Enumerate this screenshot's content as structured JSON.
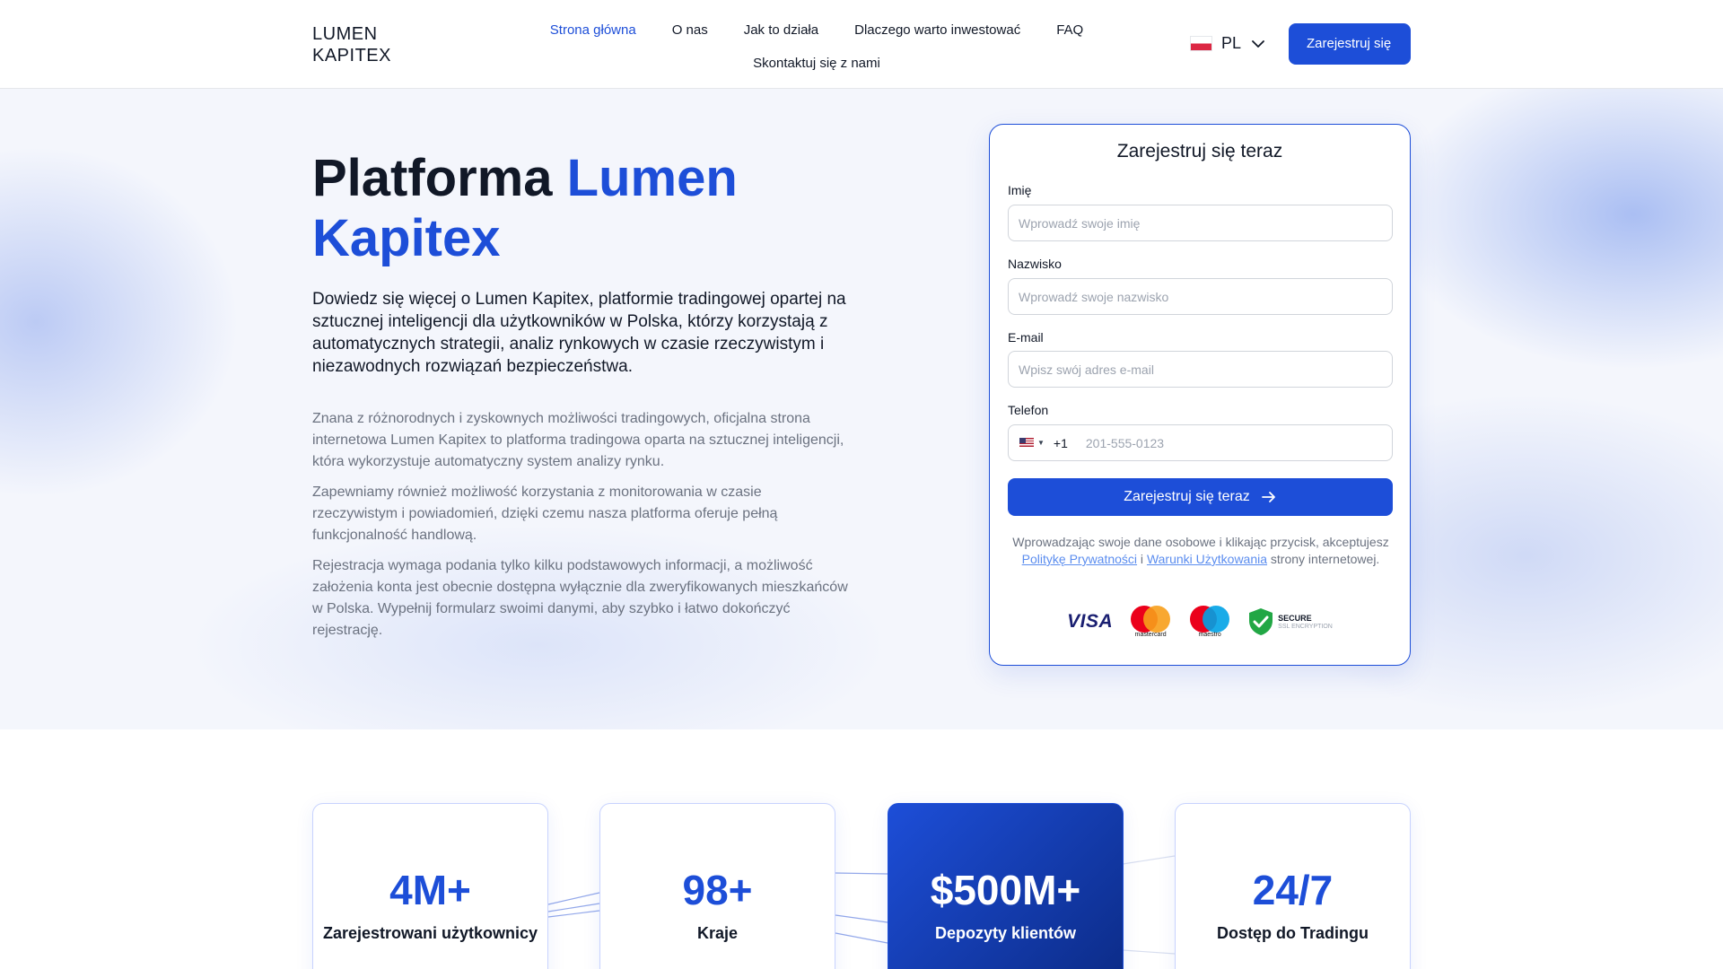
{
  "header": {
    "logo": "LUMEN\nKAPITEX",
    "nav": [
      "Strona główna",
      "O nas",
      "Jak to działa",
      "Dlaczego warto inwestować",
      "FAQ",
      "Skontaktuj się z nami"
    ],
    "language": "PL",
    "register_button": "Zarejestruj się"
  },
  "hero": {
    "title_part1": "Platforma ",
    "title_accent": "Lumen Kapitex",
    "lead": "Dowiedz się więcej o Lumen Kapitex, platformie tradingowej opartej na sztucznej inteligencji dla użytkowników w Polska, którzy korzystają z automatycznych strategii, analiz rynkowych w czasie rzeczywistym i niezawodnych rozwiązań bezpieczeństwa.",
    "paragraphs": [
      "Znana z różnorodnych i zyskownych możliwości tradingowych, oficjalna strona internetowa Lumen Kapitex to platforma tradingowa oparta na sztucznej inteligencji, która wykorzystuje automatyczny system analizy rynku.",
      "Zapewniamy również możliwość korzystania z monitorowania w czasie rzeczywistym i powiadomień, dzięki czemu nasza platforma oferuje pełną funkcjonalność handlową.",
      "Rejestracja wymaga podania tylko kilku podstawowych informacji, a możliwość założenia konta jest obecnie dostępna wyłącznie dla zweryfikowanych mieszkańców w Polska. Wypełnij formularz swoimi danymi, aby szybko i łatwo dokończyć rejestrację."
    ]
  },
  "form": {
    "title": "Zarejestruj się teraz",
    "first_name_label": "Imię",
    "first_name_placeholder": "Wprowadź swoje imię",
    "last_name_label": "Nazwisko",
    "last_name_placeholder": "Wprowadź swoje nazwisko",
    "email_label": "E-mail",
    "email_placeholder": "Wpisz swój adres e-mail",
    "phone_label": "Telefon",
    "phone_dial_code": "+1",
    "phone_placeholder": "201-555-0123",
    "submit": "Zarejestruj się teraz",
    "consent_before": "Wprowadzając swoje dane osobowe i klikając przycisk, akceptujesz ",
    "privacy_link": "Politykę Prywatności",
    "consent_and": " i ",
    "terms_link": "Warunki Użytkowania",
    "consent_after": " strony internetowej.",
    "payment_logos": {
      "visa": "VISA",
      "mastercard": "mastercard",
      "maestro": "maestro",
      "secure_title": "SECURE",
      "secure_sub": "SSL ENCRYPTION"
    }
  },
  "stats": [
    {
      "value": "4M+",
      "label": "Zarejestrowani użytkownicy"
    },
    {
      "value": "98+",
      "label": "Kraje"
    },
    {
      "value": "$500M+",
      "label": "Depozyty klientów"
    },
    {
      "value": "24/7",
      "label": "Dostęp do Tradingu"
    }
  ],
  "colors": {
    "accent": "#1d4ed8",
    "text": "#111827",
    "muted": "#6b7280"
  }
}
